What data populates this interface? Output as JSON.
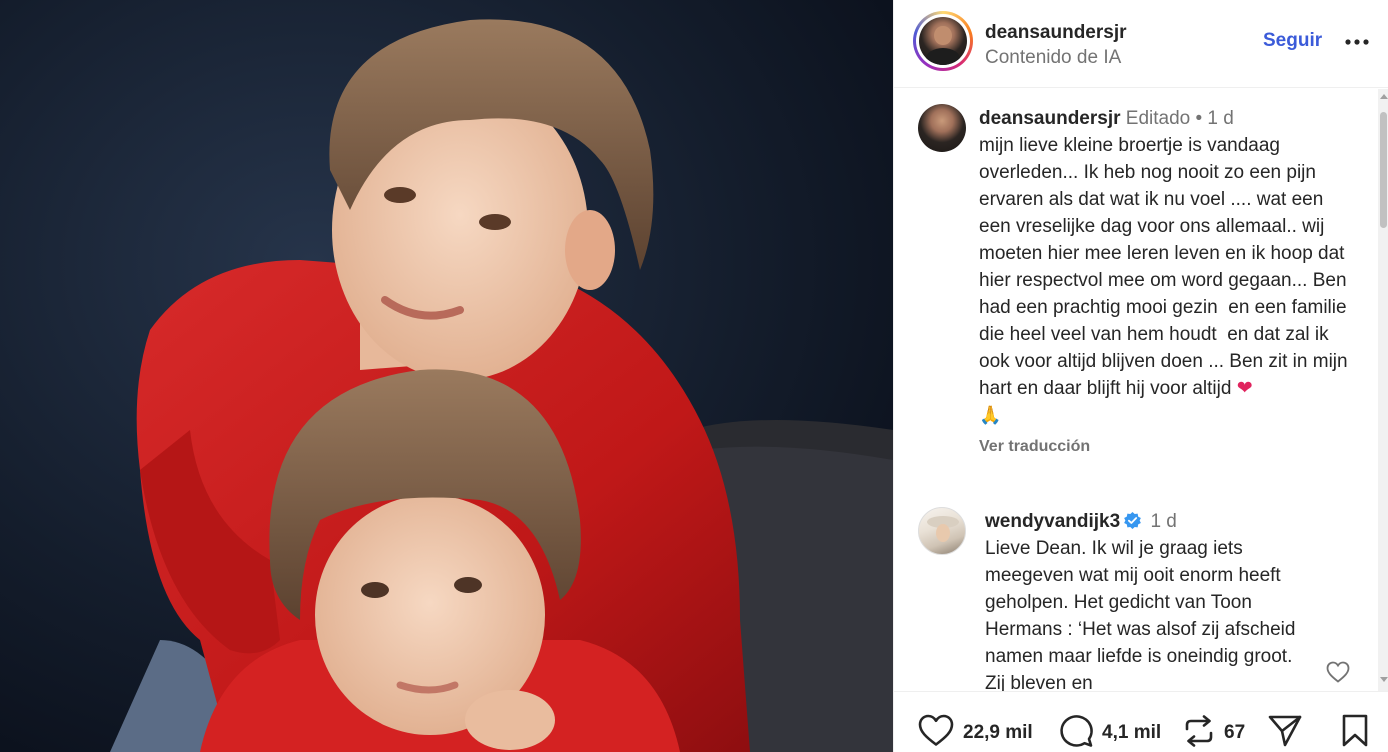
{
  "post": {
    "username": "deansaundersjr",
    "subtitle": "Contenido de IA",
    "follow_label": "Seguir",
    "more_icon": "more-horizontal-icon"
  },
  "comments": [
    {
      "username": "deansaundersjr",
      "meta": "Editado • 1 d",
      "text": "mijn lieve kleine broertje is vandaag overleden... Ik heb nog nooit zo een pijn ervaren als dat wat ik nu voel .... wat een een vreselijke dag voor ons allemaal.. wij moeten hier mee leren leven en ik hoop dat hier respectvol mee om word gegaan... Ben had een prachtig mooi gezin  en een familie die heel veel van hem houdt  en dat zal ik ook voor altijd blijven doen ... Ben zit in mijn hart en daar blijft hij voor altijd",
      "emoji_heart": "❤",
      "emoji_pray": "🙏",
      "translate_label": "Ver traducción"
    },
    {
      "username": "wendyvandijk3",
      "verified": true,
      "meta": "1 d",
      "text": "Lieve Dean. Ik wil je graag iets meegeven wat mij ooit enorm heeft geholpen. Het gedicht van Toon Hermans : ‘Het was alsof zij afscheid namen maar liefde is oneindig groot. Zij bleven en"
    }
  ],
  "actions": {
    "likes": "22,9 mil",
    "comments": "4,1 mil",
    "reposts": "67"
  },
  "colors": {
    "accent": "#3b5bd9",
    "verified": "#3797f0",
    "muted": "#737373"
  }
}
